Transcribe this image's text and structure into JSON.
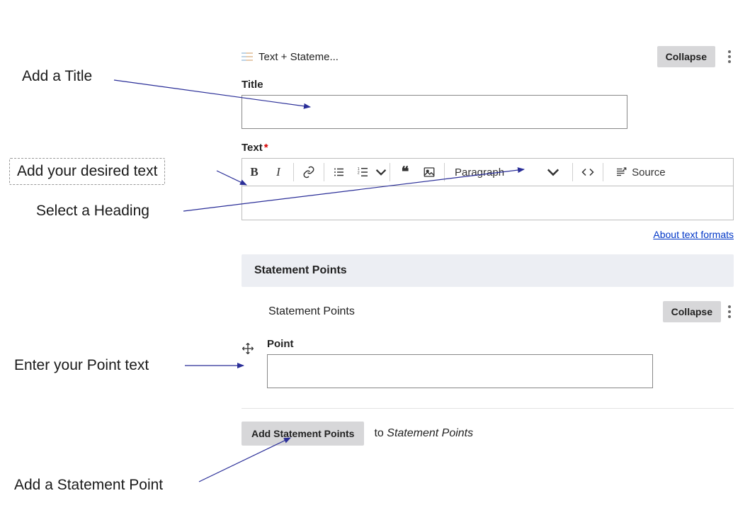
{
  "annotations": {
    "title": "Add a Title",
    "text": "Add your desired text",
    "heading": "Select a Heading",
    "point": "Enter your Point text",
    "statement": "Add a Statement Point"
  },
  "block": {
    "name": "Text + Stateme...",
    "collapse_label": "Collapse"
  },
  "fields": {
    "title": {
      "label": "Title",
      "value": ""
    },
    "text": {
      "label": "Text",
      "required": true
    }
  },
  "toolbar": {
    "format_selected": "Paragraph",
    "source_label": "Source"
  },
  "about_link": "About text formats",
  "section": {
    "header": "Statement Points",
    "subtitle": "Statement Points",
    "collapse_label": "Collapse",
    "point_label": "Point",
    "point_value": "",
    "add_button": "Add Statement Points",
    "add_to_prefix": "to",
    "add_to_target": "Statement Points"
  }
}
